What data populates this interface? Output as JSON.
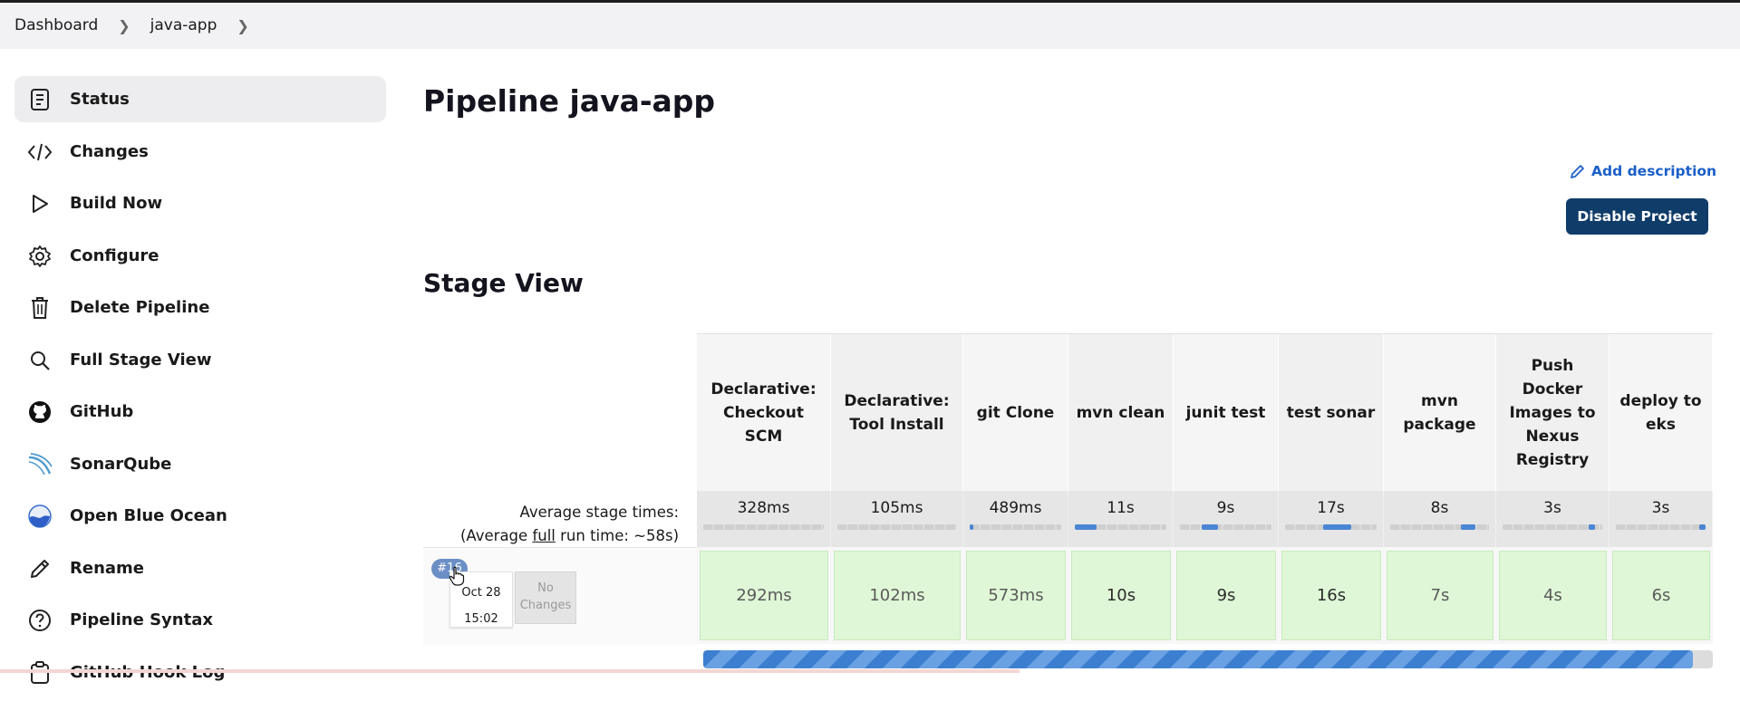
{
  "breadcrumb": {
    "items": [
      "Dashboard",
      "java-app"
    ]
  },
  "sidebar": {
    "items": [
      {
        "label": "Status",
        "icon": "status-icon",
        "active": true
      },
      {
        "label": "Changes",
        "icon": "code-icon"
      },
      {
        "label": "Build Now",
        "icon": "play-icon"
      },
      {
        "label": "Configure",
        "icon": "gear-icon"
      },
      {
        "label": "Delete Pipeline",
        "icon": "trash-icon"
      },
      {
        "label": "Full Stage View",
        "icon": "search-icon"
      },
      {
        "label": "GitHub",
        "icon": "github-icon"
      },
      {
        "label": "SonarQube",
        "icon": "sonarqube-icon"
      },
      {
        "label": "Open Blue Ocean",
        "icon": "blue-ocean-icon"
      },
      {
        "label": "Rename",
        "icon": "pencil-icon"
      },
      {
        "label": "Pipeline Syntax",
        "icon": "help-icon"
      },
      {
        "label": "GitHub Hook Log",
        "icon": "clipboard-icon"
      }
    ]
  },
  "main": {
    "title": "Pipeline java-app",
    "add_description": "Add description",
    "disable_button": "Disable Project",
    "stage_view_title": "Stage View"
  },
  "stage_view": {
    "avg_label_line1": "Average stage times:",
    "avg_label_prefix": "(Average ",
    "avg_label_link": "full",
    "avg_label_suffix": " run time: ~58s)",
    "stages": [
      {
        "name": "Declarative: Checkout SCM",
        "avg": "328ms",
        "run": "292ms",
        "bar": [
          0.0,
          0.0
        ]
      },
      {
        "name": "Declarative: Tool Install",
        "avg": "105ms",
        "run": "102ms",
        "bar": [
          0.0,
          0.0
        ]
      },
      {
        "name": "git Clone",
        "avg": "489ms",
        "run": "573ms",
        "bar": [
          0.0,
          0.03
        ]
      },
      {
        "name": "mvn clean",
        "avg": "11s",
        "run": "10s",
        "bar": [
          0.0,
          0.24
        ]
      },
      {
        "name": "junit test",
        "avg": "9s",
        "run": "9s",
        "bar": [
          0.24,
          0.42
        ]
      },
      {
        "name": "test sonar",
        "avg": "17s",
        "run": "16s",
        "bar": [
          0.42,
          0.72
        ]
      },
      {
        "name": "mvn package",
        "avg": "8s",
        "run": "7s",
        "bar": [
          0.72,
          0.86
        ]
      },
      {
        "name": "Push Docker Images to Nexus Registry",
        "avg": "3s",
        "run": "4s",
        "bar": [
          0.86,
          0.93
        ]
      },
      {
        "name": "deploy to eks",
        "avg": "3s",
        "run": "6s",
        "bar": [
          0.93,
          1.0
        ]
      }
    ],
    "build": {
      "number": "#16",
      "date": "Oct 28",
      "time": "15:02",
      "changes": "No Changes",
      "progress": 0.98
    }
  },
  "colors": {
    "primary_button": "#0f3c69",
    "link": "#1a5fc8",
    "success_cell": "#dff7d6",
    "progress": "#3c7fd0"
  }
}
